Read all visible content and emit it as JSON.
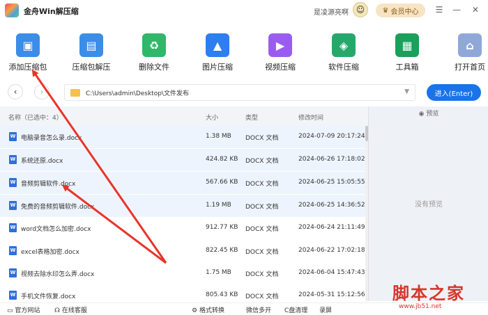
{
  "titlebar": {
    "app_title": "金舟Win解压缩",
    "user_name": "是凌源亮啊",
    "vip_label": "会员中心",
    "menu_icon": "menu-icon",
    "minimize_icon": "minimize-icon",
    "close_icon": "close-icon"
  },
  "toolbar": {
    "items": [
      {
        "label": "添加压缩包",
        "icon": "add-archive-icon",
        "color": "#3b8de8"
      },
      {
        "label": "压缩包解压",
        "icon": "extract-icon",
        "color": "#3b8de8"
      },
      {
        "label": "删除文件",
        "icon": "recycle-icon",
        "color": "#2fb86a"
      },
      {
        "label": "图片压缩",
        "icon": "image-icon",
        "color": "#2d7ef0"
      },
      {
        "label": "视频压缩",
        "icon": "video-icon",
        "color": "#9a5cf0"
      },
      {
        "label": "软件压缩",
        "icon": "software-icon",
        "color": "#27a86b"
      },
      {
        "label": "工具箱",
        "icon": "toolbox-icon",
        "color": "#19a05a"
      },
      {
        "label": "打开首页",
        "icon": "home-icon",
        "color": "#8fa8d8"
      }
    ]
  },
  "pathbar": {
    "path": "C:\\Users\\admin\\Desktop\\文件发布",
    "enter_label": "进入(Enter)"
  },
  "list": {
    "headers": {
      "name": "名称（已选中：4）",
      "size": "大小",
      "type": "类型",
      "mtime": "修改时间"
    },
    "rows": [
      {
        "name": "电脑录音怎么录.docx",
        "size": "1.38 MB",
        "type": "DOCX 文档",
        "mtime": "2024-07-09 20:17:24",
        "selected": true
      },
      {
        "name": "系统还原.docx",
        "size": "424.82 KB",
        "type": "DOCX 文档",
        "mtime": "2024-06-26 17:18:02",
        "selected": true
      },
      {
        "name": "音频剪辑软件.docx",
        "size": "567.66 KB",
        "type": "DOCX 文档",
        "mtime": "2024-06-25 15:05:55",
        "selected": true
      },
      {
        "name": "免费的音频剪辑软件.docx",
        "size": "1.19 MB",
        "type": "DOCX 文档",
        "mtime": "2024-06-25 14:36:52",
        "selected": true
      },
      {
        "name": "word文档怎么加密.docx",
        "size": "912.77 KB",
        "type": "DOCX 文档",
        "mtime": "2024-06-24 21:11:49",
        "selected": false
      },
      {
        "name": "excel表格加密.docx",
        "size": "822.45 KB",
        "type": "DOCX 文档",
        "mtime": "2024-06-22 17:02:18",
        "selected": false
      },
      {
        "name": "视频去除水印怎么弄.docx",
        "size": "1.75 MB",
        "type": "DOCX 文档",
        "mtime": "2024-06-04 15:47:43",
        "selected": false
      },
      {
        "name": "手机文件恢复.docx",
        "size": "805.43 KB",
        "type": "DOCX 文档",
        "mtime": "2024-05-31 15:12:56",
        "selected": false
      }
    ]
  },
  "preview": {
    "header": "预览",
    "empty": "没有预览"
  },
  "statusbar": {
    "website": "官方网站",
    "support": "在线客服",
    "convert": "格式转换",
    "multi_open": "微信多开",
    "c_clean": "C盘清理",
    "record": "录屏"
  },
  "watermark": {
    "text": "脚本之家",
    "url": "www.jb51.net"
  }
}
